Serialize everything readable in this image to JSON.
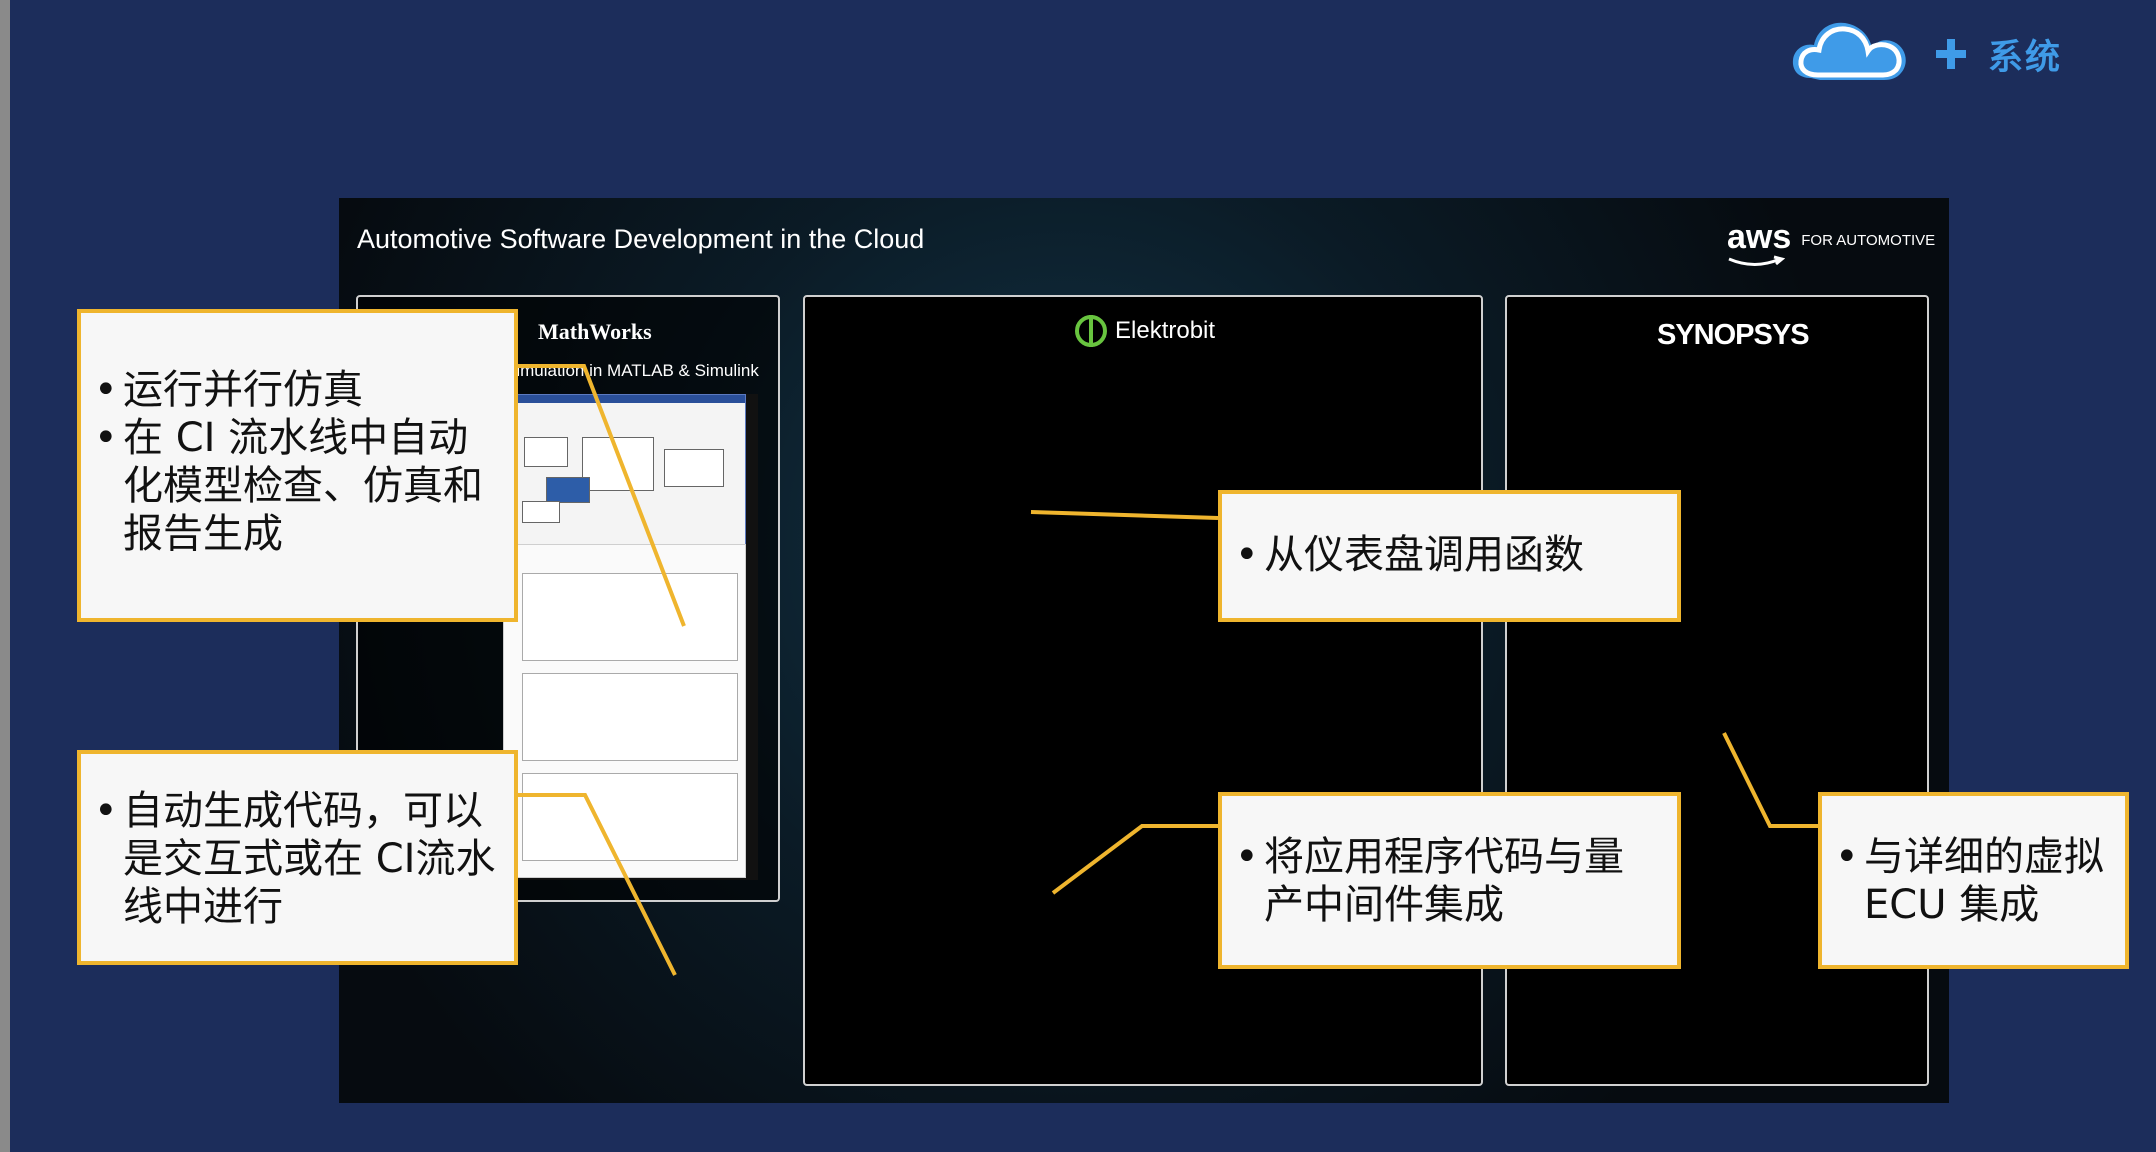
{
  "header": {
    "brand_text": "系统",
    "icons": [
      "cloud-icon",
      "plus-icon"
    ],
    "brand_color": "#3f9be8"
  },
  "slide": {
    "title": "Automotive Software Development in the Cloud",
    "aws_logo": {
      "main": "aws",
      "sub": "FOR AUTOMOTIVE"
    },
    "panels": {
      "mathworks": {
        "logo": "MathWorks",
        "subtitle": "Simulation in MATLAB & Simulink"
      },
      "elektrobit": {
        "logo": "Elektrobit"
      },
      "synopsys": {
        "logo": "SYNOPSYS"
      }
    }
  },
  "callouts": [
    {
      "items": [
        "运行并行仿真",
        "在 CI 流水线中自动化模型检查、仿真和报告生成"
      ]
    },
    {
      "items": [
        "自动生成代码，可以是交互式或在 CI流水线中进行"
      ]
    },
    {
      "items": [
        "从仪表盘调用函数"
      ]
    },
    {
      "items": [
        "将应用程序代码与量产中间件集成"
      ]
    },
    {
      "items": [
        "与详细的虚拟 ECU 集成"
      ]
    }
  ],
  "colors": {
    "background": "#1c2d5b",
    "callout_border": "#efb52e",
    "callout_fill": "#f7f7f7",
    "elektrobit_green": "#68c43f"
  }
}
